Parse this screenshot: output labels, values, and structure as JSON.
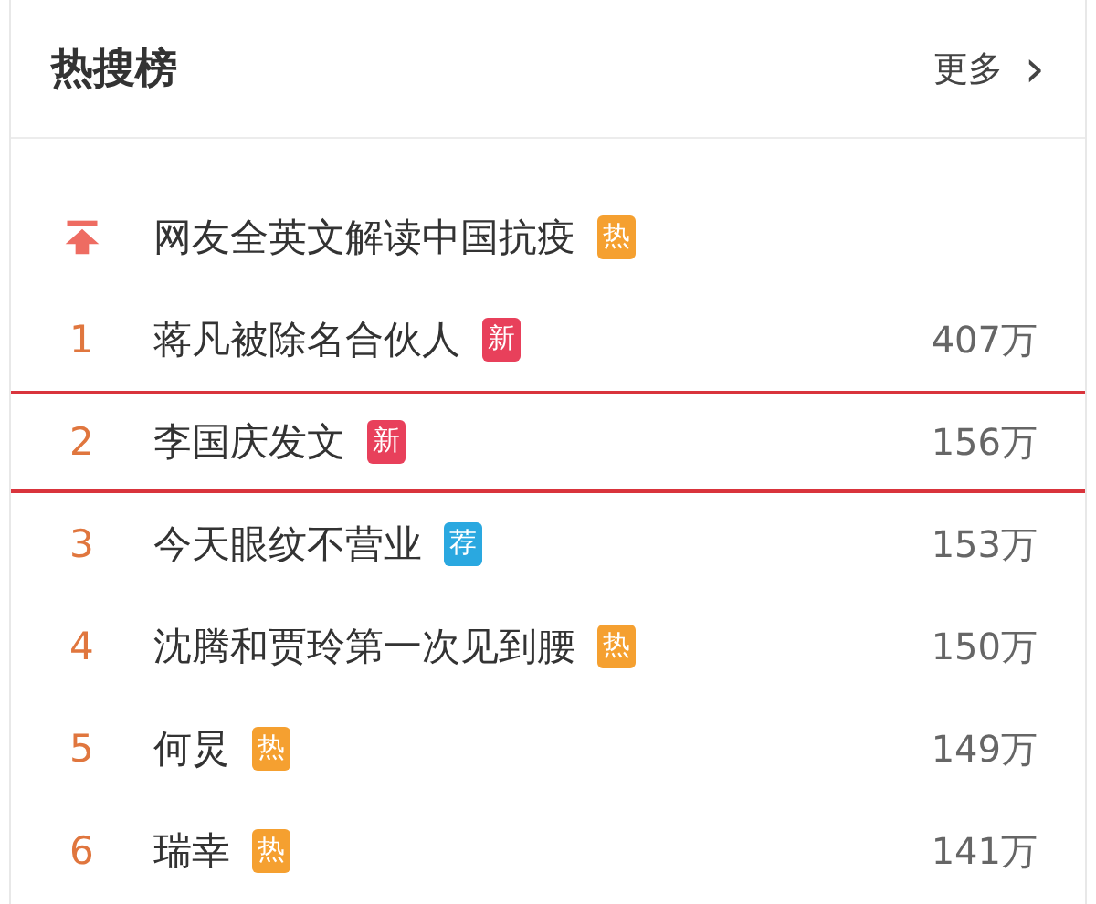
{
  "header": {
    "title": "热搜榜",
    "more": "更多",
    "more_arrow": "›"
  },
  "rows": [
    {
      "kind": "pinned",
      "title": "网友全英文解读中国抗疫",
      "badge": {
        "kind": "hot",
        "text": "热"
      },
      "highlighted": false
    },
    {
      "kind": "ranked",
      "rank": "1",
      "title": "蒋凡被除名合伙人",
      "badge": {
        "kind": "new",
        "text": "新"
      },
      "count": "407万",
      "highlighted": false
    },
    {
      "kind": "ranked",
      "rank": "2",
      "title": "李国庆发文",
      "badge": {
        "kind": "new",
        "text": "新"
      },
      "count": "156万",
      "highlighted": true
    },
    {
      "kind": "ranked",
      "rank": "3",
      "title": "今天眼纹不营业",
      "badge": {
        "kind": "rec",
        "text": "荐"
      },
      "count": "153万",
      "highlighted": false
    },
    {
      "kind": "ranked",
      "rank": "4",
      "title": "沈腾和贾玲第一次见到腰",
      "badge": {
        "kind": "hot",
        "text": "热"
      },
      "count": "150万",
      "highlighted": false
    },
    {
      "kind": "ranked",
      "rank": "5",
      "title": "何炅",
      "badge": {
        "kind": "hot",
        "text": "热"
      },
      "count": "149万",
      "highlighted": false
    },
    {
      "kind": "ranked",
      "rank": "6",
      "title": "瑞幸",
      "badge": {
        "kind": "hot",
        "text": "热"
      },
      "count": "141万",
      "highlighted": false
    }
  ]
}
